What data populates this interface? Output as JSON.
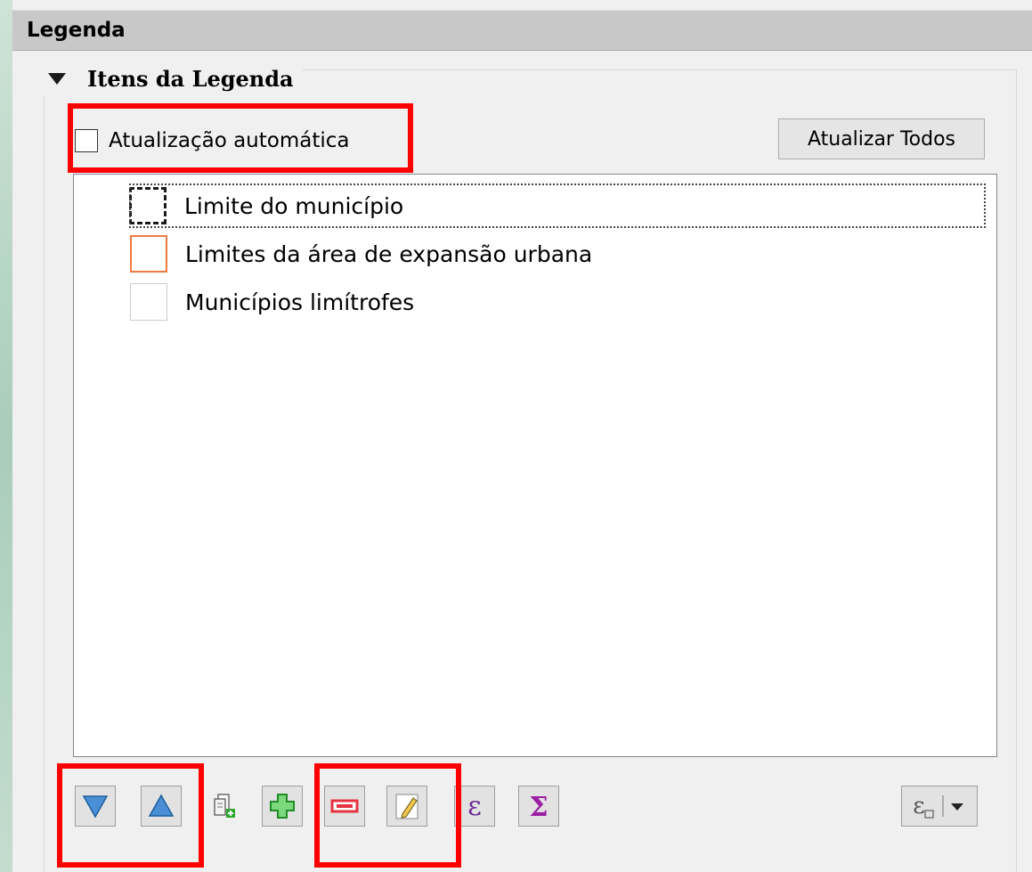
{
  "panel": {
    "title": "Legenda"
  },
  "group": {
    "title": "Itens da Legenda"
  },
  "auto_update": {
    "label": "Atualização automática",
    "checked": false
  },
  "update_all_button": {
    "label": "Atualizar Todos"
  },
  "legend_items": [
    {
      "label": "Limite do município",
      "symbol": "dashed-black-outline",
      "selected": true
    },
    {
      "label": "Limites da área de expansão urbana",
      "symbol": "orange-outline"
    },
    {
      "label": "Municípios limítrofes",
      "symbol": "light-grey-outline"
    }
  ],
  "toolbar": {
    "buttons": [
      {
        "icon": "arrow-down-icon"
      },
      {
        "icon": "arrow-up-icon"
      },
      {
        "icon": "add-group-icon"
      },
      {
        "icon": "plus-icon"
      },
      {
        "icon": "minus-icon"
      },
      {
        "icon": "pencil-icon"
      },
      {
        "icon": "epsilon-icon",
        "glyph": "ε"
      },
      {
        "icon": "sigma-icon",
        "glyph": "Σ"
      },
      {
        "icon": "expression-dropdown-icon",
        "glyph": "ε"
      }
    ]
  },
  "colors": {
    "highlight": "#ff0000",
    "accent_blue": "#4a8fd6",
    "plus_green": "#2fa832",
    "minus_red": "#e6333f",
    "sigma_purple": "#9b1ea3",
    "epsilon_purple": "#6b2a91",
    "orange_symbol": "#f07a43"
  }
}
